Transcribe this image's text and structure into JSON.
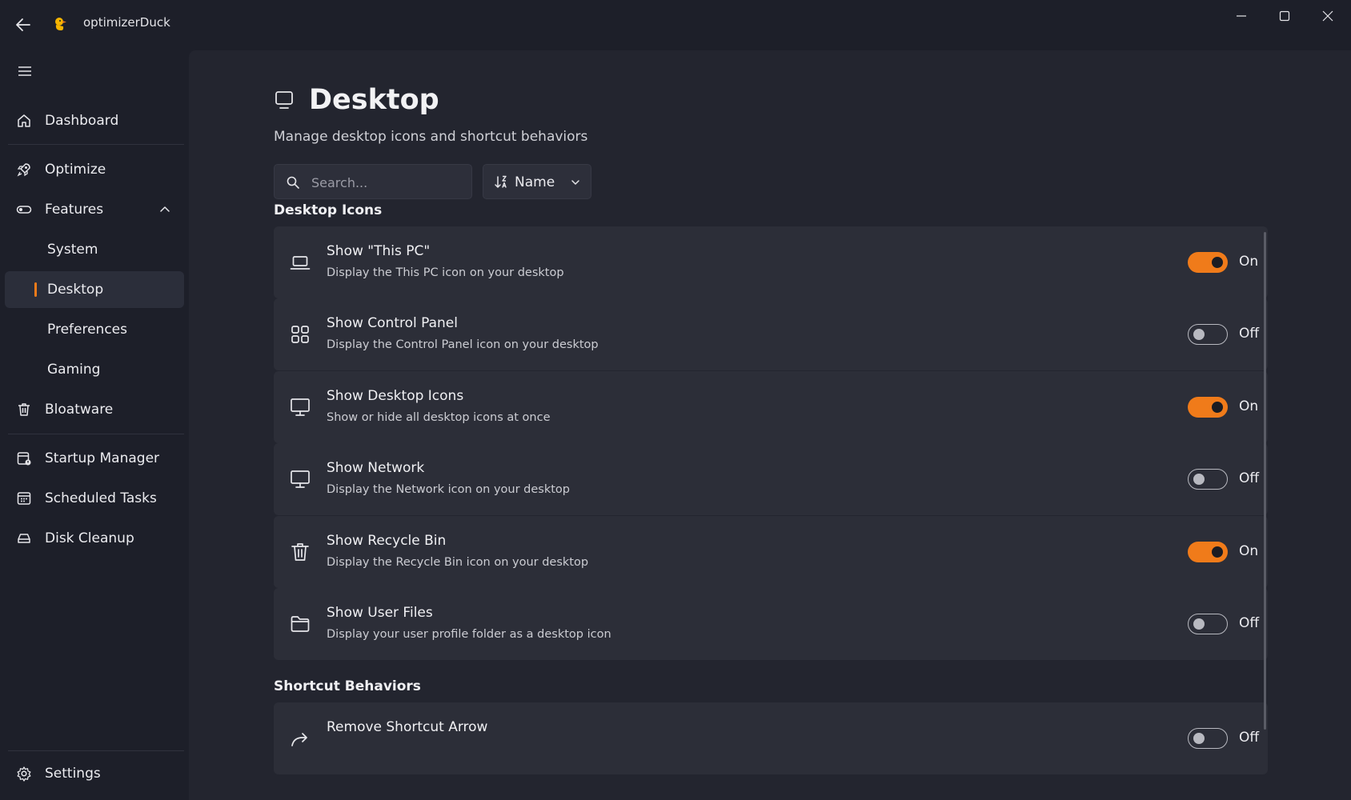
{
  "app": {
    "title": "optimizerDuck"
  },
  "colors": {
    "accent": "#f07b1a",
    "background": "#1d1f29",
    "card": "#2c2e38"
  },
  "sidebar": {
    "items": [
      {
        "label": "Dashboard",
        "icon": "home-icon"
      },
      {
        "label": "Optimize",
        "icon": "rocket-icon"
      },
      {
        "label": "Features",
        "icon": "toggle-icon",
        "expanded": true
      },
      {
        "label": "System",
        "sub": true
      },
      {
        "label": "Desktop",
        "sub": true,
        "active": true
      },
      {
        "label": "Preferences",
        "sub": true
      },
      {
        "label": "Gaming",
        "sub": true
      },
      {
        "label": "Bloatware",
        "icon": "trash-icon"
      },
      {
        "label": "Startup Manager",
        "icon": "startup-icon"
      },
      {
        "label": "Scheduled Tasks",
        "icon": "calendar-icon"
      },
      {
        "label": "Disk Cleanup",
        "icon": "drive-icon"
      }
    ],
    "settings_label": "Settings"
  },
  "page": {
    "title": "Desktop",
    "subtitle": "Manage desktop icons and shortcut behaviors",
    "search_placeholder": "Search...",
    "sort_label": "Name"
  },
  "sections": [
    {
      "title": "Desktop Icons",
      "settings": [
        {
          "title": "Show \"This PC\"",
          "description": "Display the This PC icon on your desktop",
          "enabled": true,
          "state_label": "On",
          "icon": "laptop-icon"
        },
        {
          "title": "Show Control Panel",
          "description": "Display the Control Panel icon on your desktop",
          "enabled": false,
          "state_label": "Off",
          "icon": "grid-icon"
        },
        {
          "title": "Show Desktop Icons",
          "description": "Show or hide all desktop icons at once",
          "enabled": true,
          "state_label": "On",
          "icon": "monitor-icon"
        },
        {
          "title": "Show Network",
          "description": "Display the Network icon on your desktop",
          "enabled": false,
          "state_label": "Off",
          "icon": "monitor-icon"
        },
        {
          "title": "Show Recycle Bin",
          "description": "Display the Recycle Bin icon on your desktop",
          "enabled": true,
          "state_label": "On",
          "icon": "trash-icon"
        },
        {
          "title": "Show User Files",
          "description": "Display your user profile folder as a desktop icon",
          "enabled": false,
          "state_label": "Off",
          "icon": "folder-icon"
        }
      ]
    },
    {
      "title": "Shortcut Behaviors",
      "settings": [
        {
          "title": "Remove Shortcut Arrow",
          "description": "",
          "enabled": false,
          "state_label": "Off",
          "icon": "share-arrow-icon"
        }
      ]
    }
  ]
}
